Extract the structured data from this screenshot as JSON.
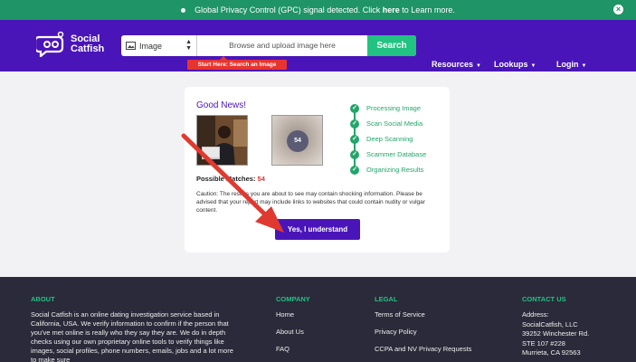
{
  "gpc_banner": {
    "text_before": "Global Privacy Control (GPC) signal detected. Click",
    "link": "here",
    "text_after": "to Learn more."
  },
  "header": {
    "logo_line1": "Social",
    "logo_line2": "Catfish",
    "search_type": "Image",
    "search_placeholder": "Browse and upload image here",
    "search_button": "Search",
    "tooltip": "Start Here: Search an Image",
    "nav": [
      "Resources",
      "Lookups",
      "Login"
    ]
  },
  "card": {
    "title": "Good News!",
    "badge_count": "54",
    "possible_matches_label": "Possible Matches:",
    "possible_matches_value": "54",
    "caution": "Caution: The results you are about to see may contain shocking information. Please be advised that your report may include links to websites that could contain nudity or vulgar content.",
    "confirm_button": "Yes, I understand",
    "steps": [
      "Processing Image",
      "Scan Social Media",
      "Deep Scanning",
      "Scammer Database",
      "Organizing Results"
    ]
  },
  "footer": {
    "about_head": "ABOUT",
    "about_text": "Social Catfish is an online dating investigation service based in California, USA. We verify information to confirm if the person that you've met online is really who they say they are. We do in depth checks using our own proprietary online tools to verify things like images, social profiles, phone numbers, emails, jobs and a lot more to make sure",
    "company_head": "COMPANY",
    "company_links": [
      "Home",
      "About Us",
      "FAQ"
    ],
    "legal_head": "LEGAL",
    "legal_links": [
      "Terms of Service",
      "Privacy Policy",
      "CCPA and NV Privacy Requests"
    ],
    "contact_head": "CONTACT US",
    "contact_lines": [
      "Address:",
      "SocialCatfish, LLC",
      "39252 Winchester Rd.",
      "STE 107 #228",
      "Murrieta, CA 92563"
    ]
  },
  "colors": {
    "brand_purple": "#4a15b8",
    "accent_green": "#22c282",
    "check_green": "#22a66a",
    "alert_red": "#e8342e"
  }
}
